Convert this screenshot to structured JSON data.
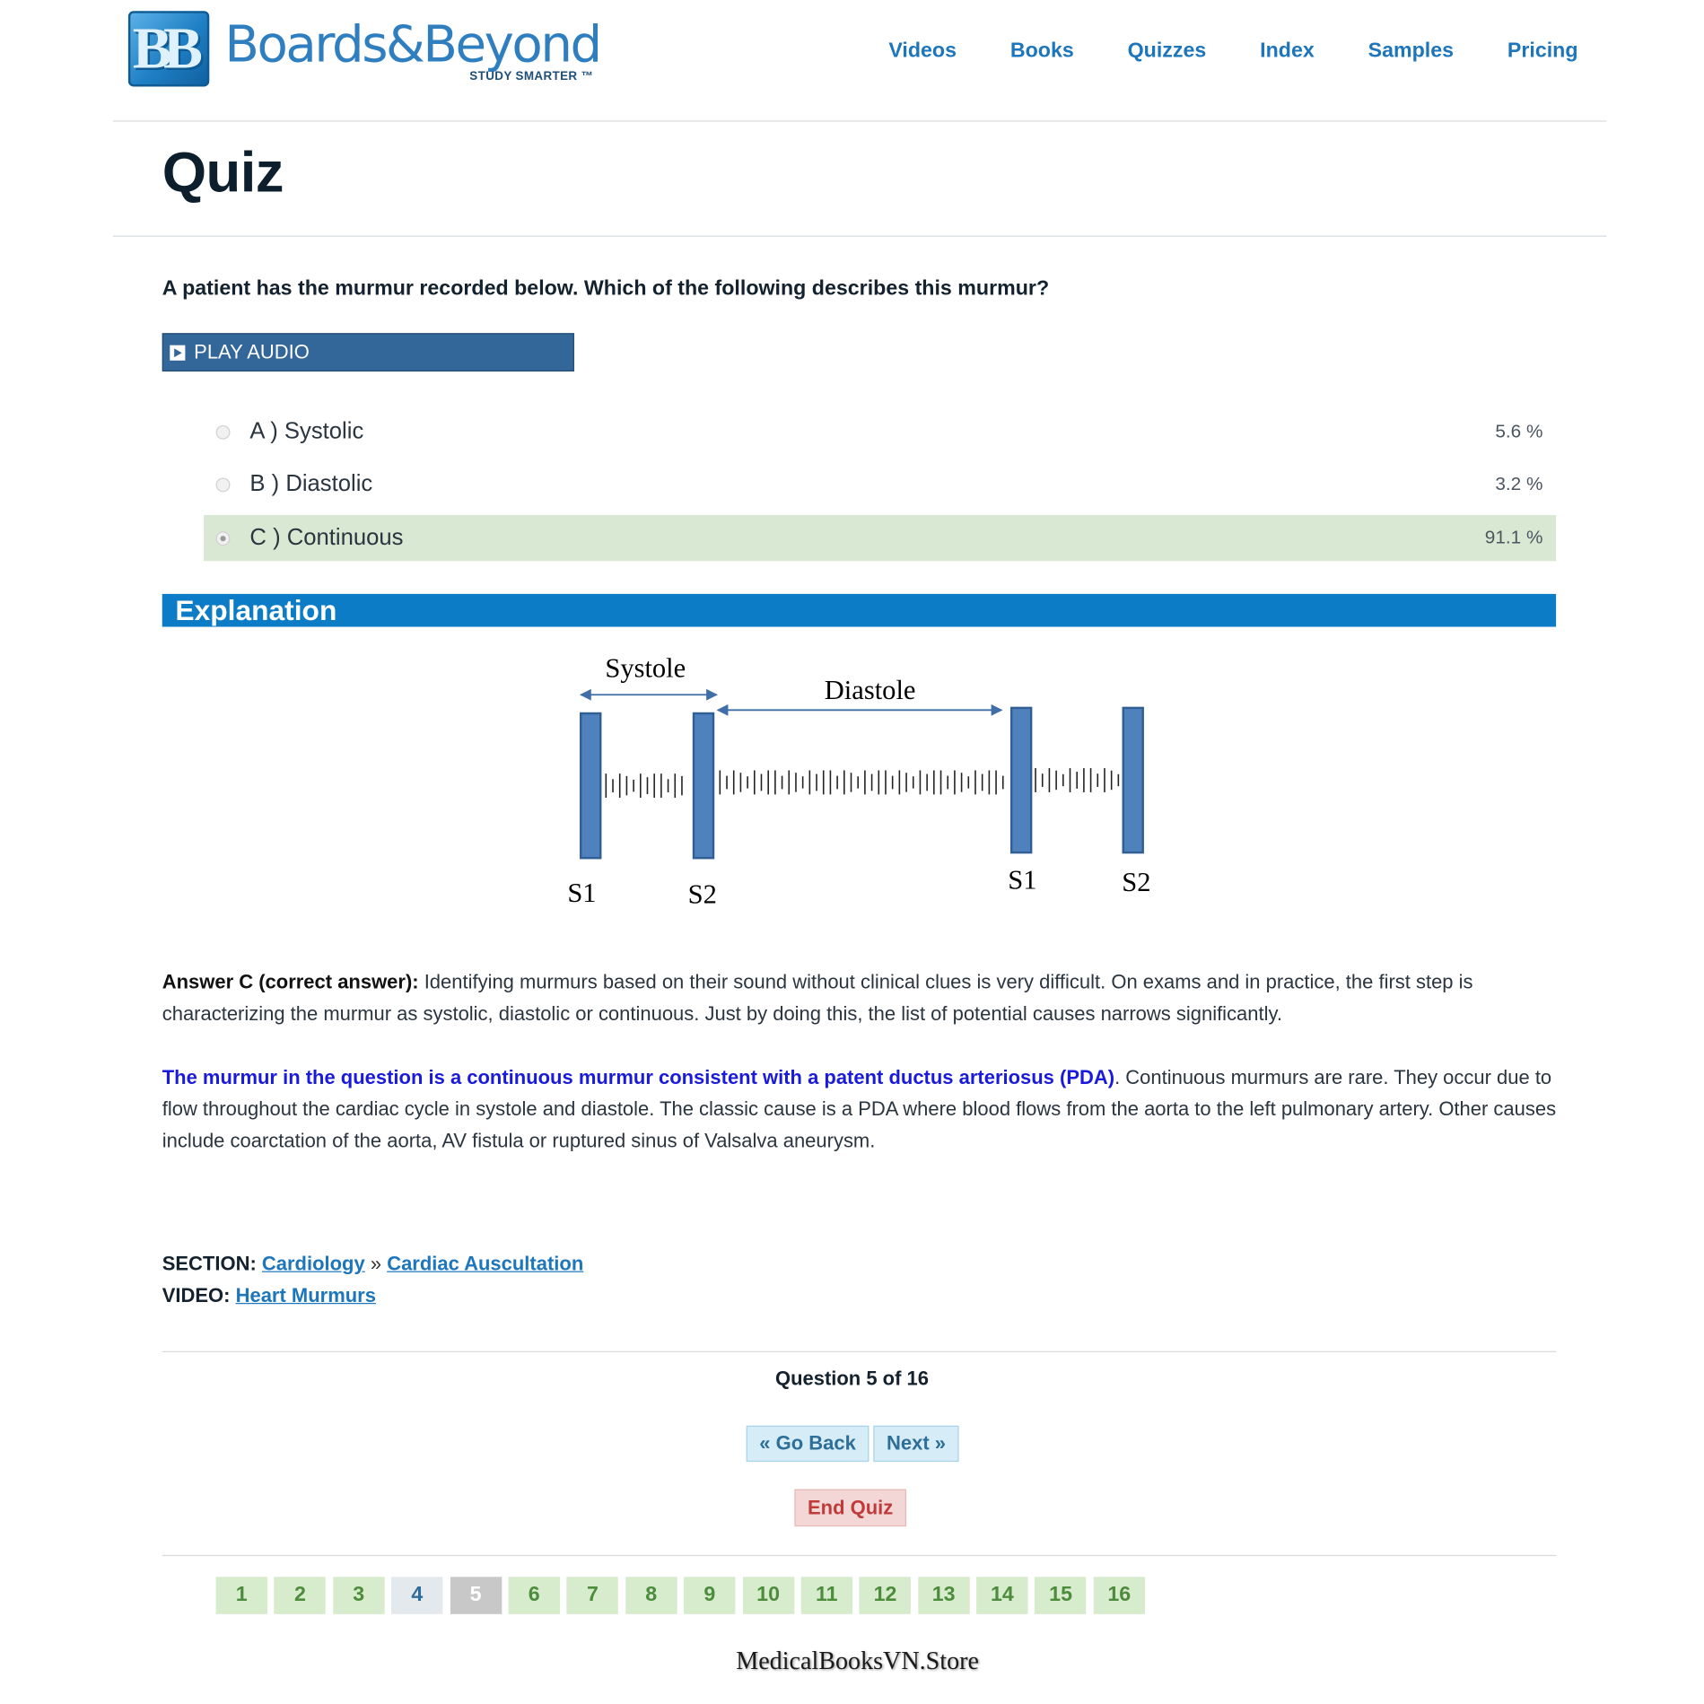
{
  "brand": {
    "logo_letters": "BB",
    "name": "Boards&Beyond",
    "tagline": "STUDY SMARTER ™"
  },
  "nav": [
    "Videos",
    "Books",
    "Quizzes",
    "Index",
    "Samples",
    "Pricing"
  ],
  "page_title": "Quiz",
  "question": {
    "text": "A patient has the murmur recorded below. Which of the following describes this murmur?",
    "play_label": "PLAY AUDIO",
    "options": [
      {
        "label": "A ) Systolic",
        "percent": "5.6 %",
        "selected": false
      },
      {
        "label": "B ) Diastolic",
        "percent": "3.2 %",
        "selected": false
      },
      {
        "label": "C ) Continuous",
        "percent": "91.1 %",
        "selected": true
      }
    ]
  },
  "explanation": {
    "heading": "Explanation",
    "diagram": {
      "systole_label": "Systole",
      "diastole_label": "Diastole",
      "beat_labels": [
        "S1",
        "S2",
        "S1",
        "S2"
      ],
      "bar_color": "#4f81bd",
      "arrow_color": "#3f6ea8"
    },
    "answer_lead": "Answer C (correct answer):",
    "answer_text": " Identifying murmurs based on their sound without clinical clues is very difficult. On exams and in practice, the first step is characterizing the murmur as systolic, diastolic or continuous. Just by doing this, the list of potential causes narrows significantly.",
    "highlight": "The murmur in the question is a continuous murmur consistent with a patent ductus arteriosus (PDA)",
    "detail_text": ". Continuous murmurs are rare. They occur due to flow throughout the cardiac cycle in systole and diastole. The classic cause is a PDA where blood flows from the aorta to the left pulmonary artery. Other causes include coarctation of the aorta, AV fistula or ruptured sinus of Valsalva aneurysm."
  },
  "section": {
    "label": "SECTION:",
    "crumbs": [
      "Cardiology",
      "Cardiac Auscultation"
    ],
    "separator": "»",
    "video_label": "VIDEO:",
    "video_link": "Heart Murmurs"
  },
  "footer": {
    "question_count": "Question 5 of 16",
    "back_label": "« Go Back",
    "next_label": "Next »",
    "end_label": "End Quiz",
    "pages": [
      "1",
      "2",
      "3",
      "4",
      "5",
      "6",
      "7",
      "8",
      "9",
      "10",
      "11",
      "12",
      "13",
      "14",
      "15",
      "16"
    ],
    "current_page": 5,
    "answered_pages": [
      4
    ],
    "watermark": "MedicalBooksVN.Store"
  },
  "colors": {
    "brand_blue": "#1d76bb",
    "explanation_bar": "#0c7cc7",
    "selected_option": "#d9e8d2",
    "play_button": "#336699",
    "end_quiz": "#c03a3a"
  }
}
